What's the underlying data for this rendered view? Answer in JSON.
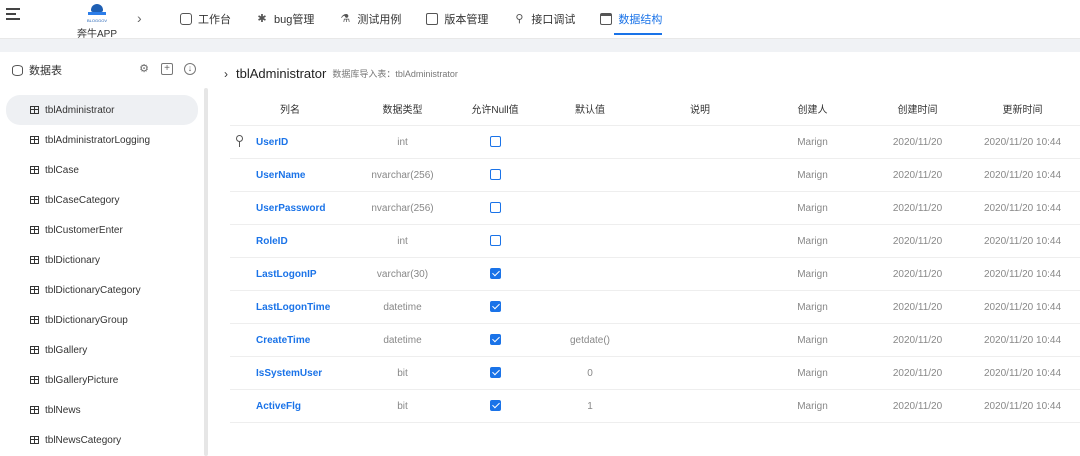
{
  "topbar": {
    "brand_sub": "BLOGGOV",
    "brand_name": "奔牛APP",
    "nav": [
      {
        "label": "工作台",
        "icon": "workbench-icon"
      },
      {
        "label": "bug管理",
        "icon": "bug-icon"
      },
      {
        "label": "测试用例",
        "icon": "test-case-icon"
      },
      {
        "label": "版本管理",
        "icon": "version-icon"
      },
      {
        "label": "接口调试",
        "icon": "api-debug-icon"
      },
      {
        "label": "数据结构",
        "icon": "data-structure-icon",
        "active": true
      }
    ]
  },
  "sidebar": {
    "title": "数据表",
    "tables": [
      "tblAdministrator",
      "tblAdministratorLogging",
      "tblCase",
      "tblCaseCategory",
      "tblCustomerEnter",
      "tblDictionary",
      "tblDictionaryCategory",
      "tblDictionaryGroup",
      "tblGallery",
      "tblGalleryPicture",
      "tblNews",
      "tblNewsCategory"
    ],
    "selected": "tblAdministrator"
  },
  "main": {
    "table_name": "tblAdministrator",
    "import_note": "数据库导入表：tblAdministrator",
    "columns": [
      "列名",
      "数据类型",
      "允许Null值",
      "默认值",
      "说明",
      "创建人",
      "创建时间",
      "更新时间"
    ],
    "rows": [
      {
        "name": "UserID",
        "type": "int",
        "nullable": false,
        "default": "",
        "desc": "",
        "creator": "Marign",
        "created": "2020/11/20",
        "updated": "2020/11/20 10:44",
        "key": true
      },
      {
        "name": "UserName",
        "type": "nvarchar(256)",
        "nullable": false,
        "default": "",
        "desc": "",
        "creator": "Marign",
        "created": "2020/11/20",
        "updated": "2020/11/20 10:44"
      },
      {
        "name": "UserPassword",
        "type": "nvarchar(256)",
        "nullable": false,
        "default": "",
        "desc": "",
        "creator": "Marign",
        "created": "2020/11/20",
        "updated": "2020/11/20 10:44"
      },
      {
        "name": "RoleID",
        "type": "int",
        "nullable": false,
        "default": "",
        "desc": "",
        "creator": "Marign",
        "created": "2020/11/20",
        "updated": "2020/11/20 10:44"
      },
      {
        "name": "LastLogonIP",
        "type": "varchar(30)",
        "nullable": true,
        "default": "",
        "desc": "",
        "creator": "Marign",
        "created": "2020/11/20",
        "updated": "2020/11/20 10:44"
      },
      {
        "name": "LastLogonTime",
        "type": "datetime",
        "nullable": true,
        "default": "",
        "desc": "",
        "creator": "Marign",
        "created": "2020/11/20",
        "updated": "2020/11/20 10:44"
      },
      {
        "name": "CreateTime",
        "type": "datetime",
        "nullable": true,
        "default": "getdate()",
        "desc": "",
        "creator": "Marign",
        "created": "2020/11/20",
        "updated": "2020/11/20 10:44"
      },
      {
        "name": "IsSystemUser",
        "type": "bit",
        "nullable": true,
        "default": "0",
        "desc": "",
        "creator": "Marign",
        "created": "2020/11/20",
        "updated": "2020/11/20 10:44"
      },
      {
        "name": "ActiveFlg",
        "type": "bit",
        "nullable": true,
        "default": "1",
        "desc": "",
        "creator": "Marign",
        "created": "2020/11/20",
        "updated": "2020/11/20 10:44"
      }
    ]
  },
  "colors": {
    "accent": "#1a73e8",
    "background": "#f0f2f5"
  }
}
